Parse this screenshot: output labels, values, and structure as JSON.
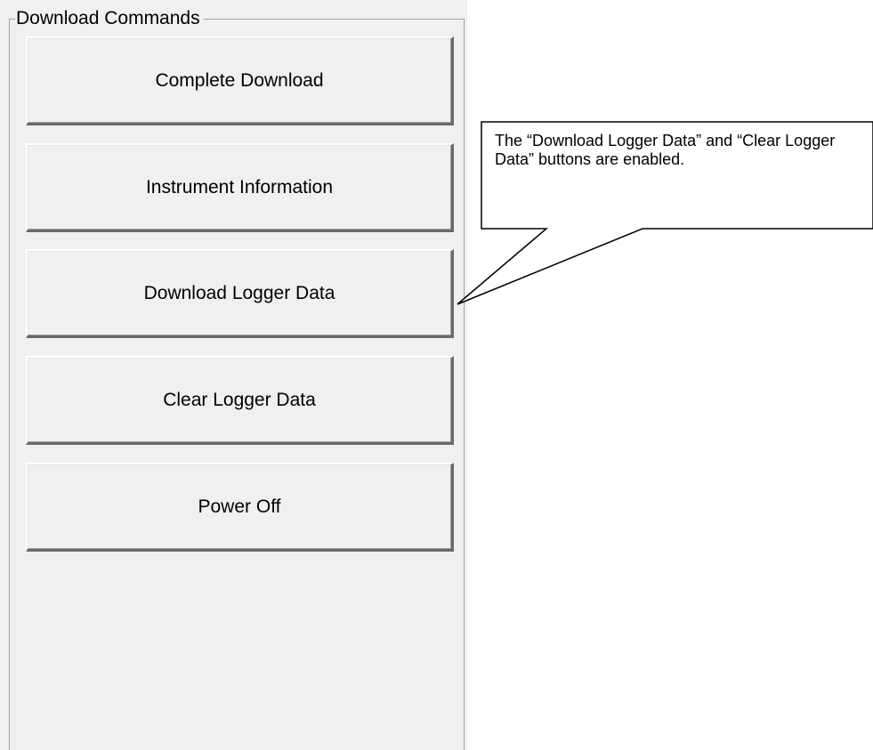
{
  "group": {
    "title": "Download Commands"
  },
  "buttons": [
    {
      "label": "Complete Download"
    },
    {
      "label": "Instrument Information"
    },
    {
      "label": "Download Logger Data"
    },
    {
      "label": "Clear Logger Data"
    },
    {
      "label": "Power Off"
    }
  ],
  "callout": {
    "text": "The “Download Logger Data” and “Clear Logger Data” buttons are enabled."
  },
  "colors": {
    "panel_bg": "#f0f0f0",
    "button_bg": "#f0f0f0",
    "callout_bg": "#ffffff",
    "callout_border": "#000000"
  }
}
